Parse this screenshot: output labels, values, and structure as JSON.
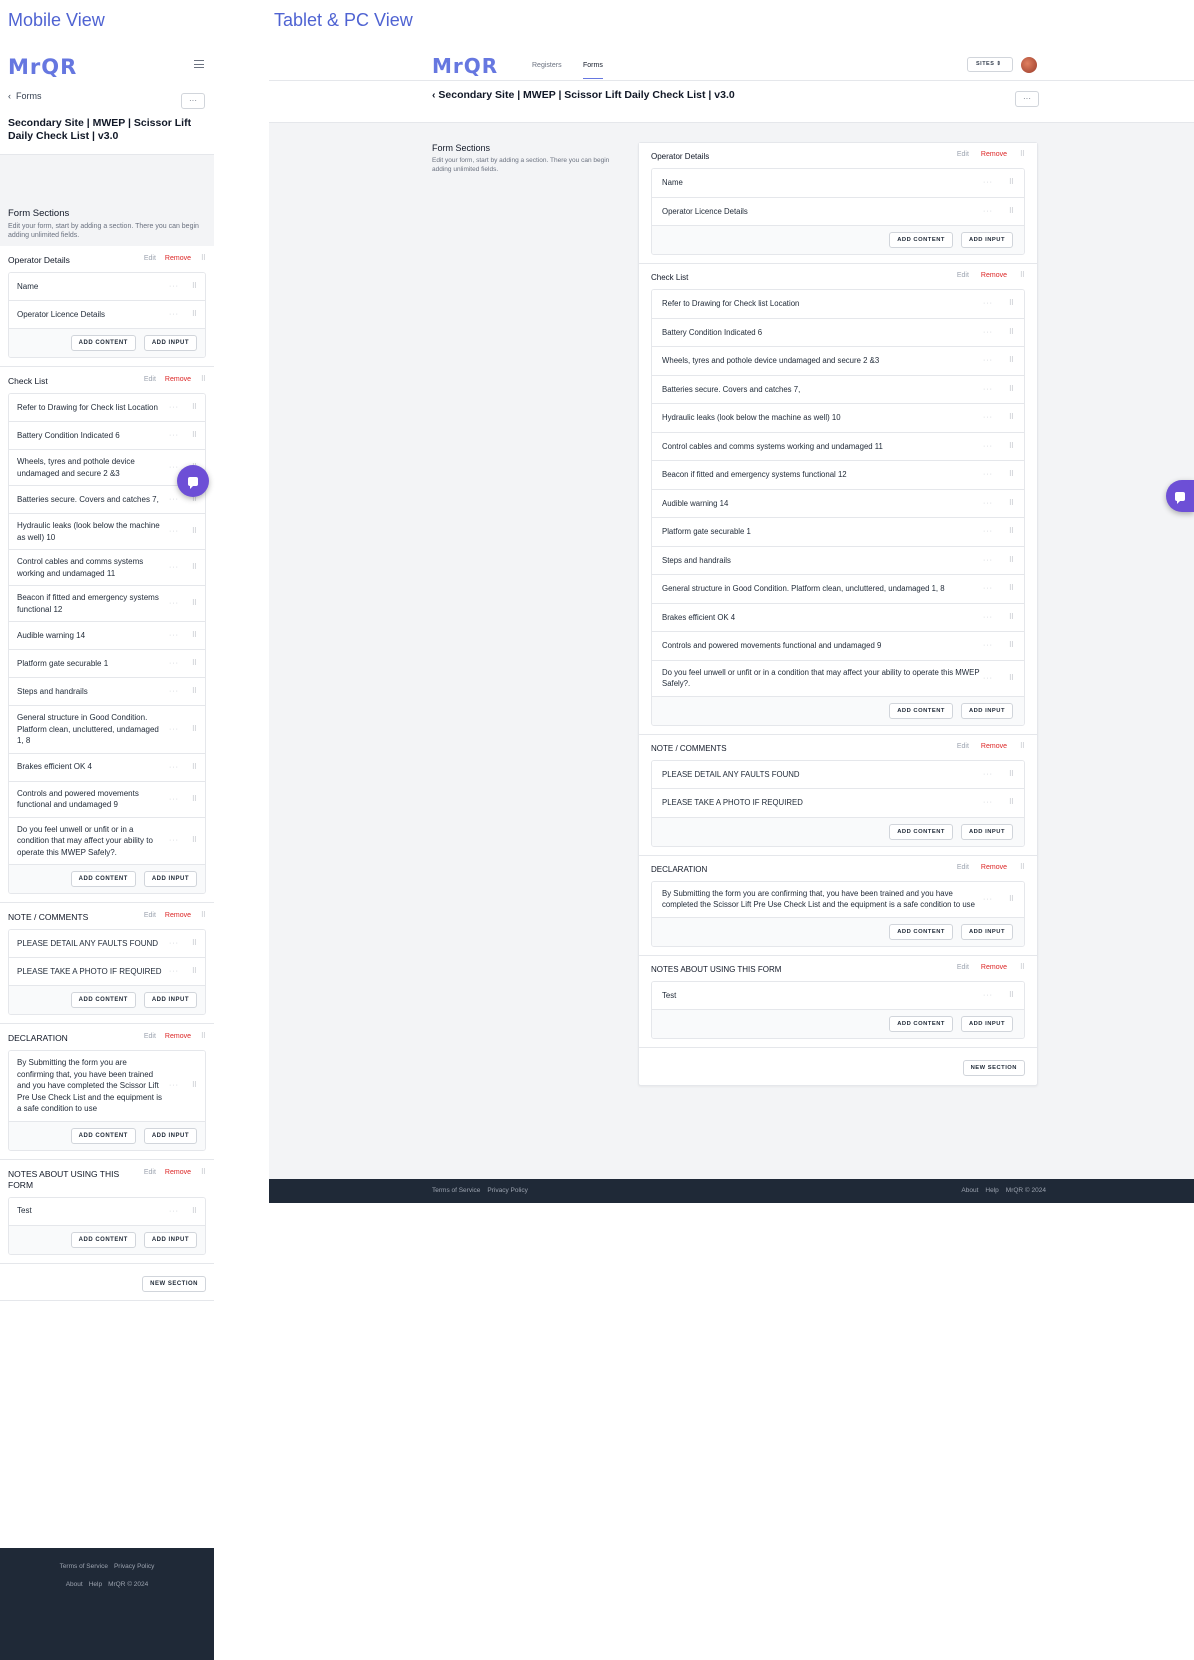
{
  "labels": {
    "mobile": "Mobile View",
    "desktop": "Tablet & PC View"
  },
  "brand": "MrQR",
  "nav": {
    "registers": "Registers",
    "forms": "Forms",
    "sites": "SITES ⇕"
  },
  "back_label": "Forms",
  "more_label": "···",
  "form_title": "Secondary Site | MWEP | Scissor Lift Daily Check List | v3.0",
  "form_sections": {
    "heading": "Form Sections",
    "description": "Edit your form, start by adding a section. There you can begin adding unlimited fields."
  },
  "actions": {
    "edit": "Edit",
    "remove": "Remove",
    "add_content": "ADD CONTENT",
    "add_input": "ADD INPUT",
    "new_section": "NEW SECTION"
  },
  "sections": [
    {
      "name": "Operator Details",
      "items": [
        "Name",
        "Operator Licence Details"
      ]
    },
    {
      "name": "Check List",
      "items": [
        "Refer to Drawing for Check list Location",
        "Battery Condition Indicated 6",
        "Wheels, tyres and pothole device undamaged and secure 2 &3",
        "Batteries secure. Covers and catches 7,",
        "Hydraulic leaks (look below the machine as well) 10",
        "Control cables and comms systems working and undamaged 11",
        "Beacon if fitted and emergency systems functional 12",
        "Audible warning 14",
        "Platform gate securable 1",
        "Steps and handrails",
        "General structure in Good Condition. Platform clean, uncluttered, undamaged 1, 8",
        "Brakes efficient OK 4",
        "Controls and powered movements functional and undamaged 9",
        "Do you feel unwell or unfit or in a condition that may affect your ability to operate this MWEP Safely?."
      ]
    },
    {
      "name": "NOTE / COMMENTS",
      "items": [
        "PLEASE DETAIL ANY FAULTS FOUND",
        "PLEASE TAKE A PHOTO IF REQUIRED"
      ]
    },
    {
      "name": "DECLARATION",
      "items": [
        "By Submitting the form you are confirming that, you have been trained and you have completed the Scissor Lift Pre Use Check List and the equipment is a safe condition to use"
      ]
    },
    {
      "name": "NOTES ABOUT USING THIS FORM",
      "items": [
        "Test"
      ]
    }
  ],
  "footer": {
    "terms": "Terms of Service",
    "privacy": "Privacy Policy",
    "about": "About",
    "help": "Help",
    "copyright": "MrQR © 2024"
  },
  "colors": {
    "brand": "#6677e0",
    "remove": "#dc2626",
    "footer_bg": "#1f2937",
    "chat": "#6d4fd6"
  }
}
